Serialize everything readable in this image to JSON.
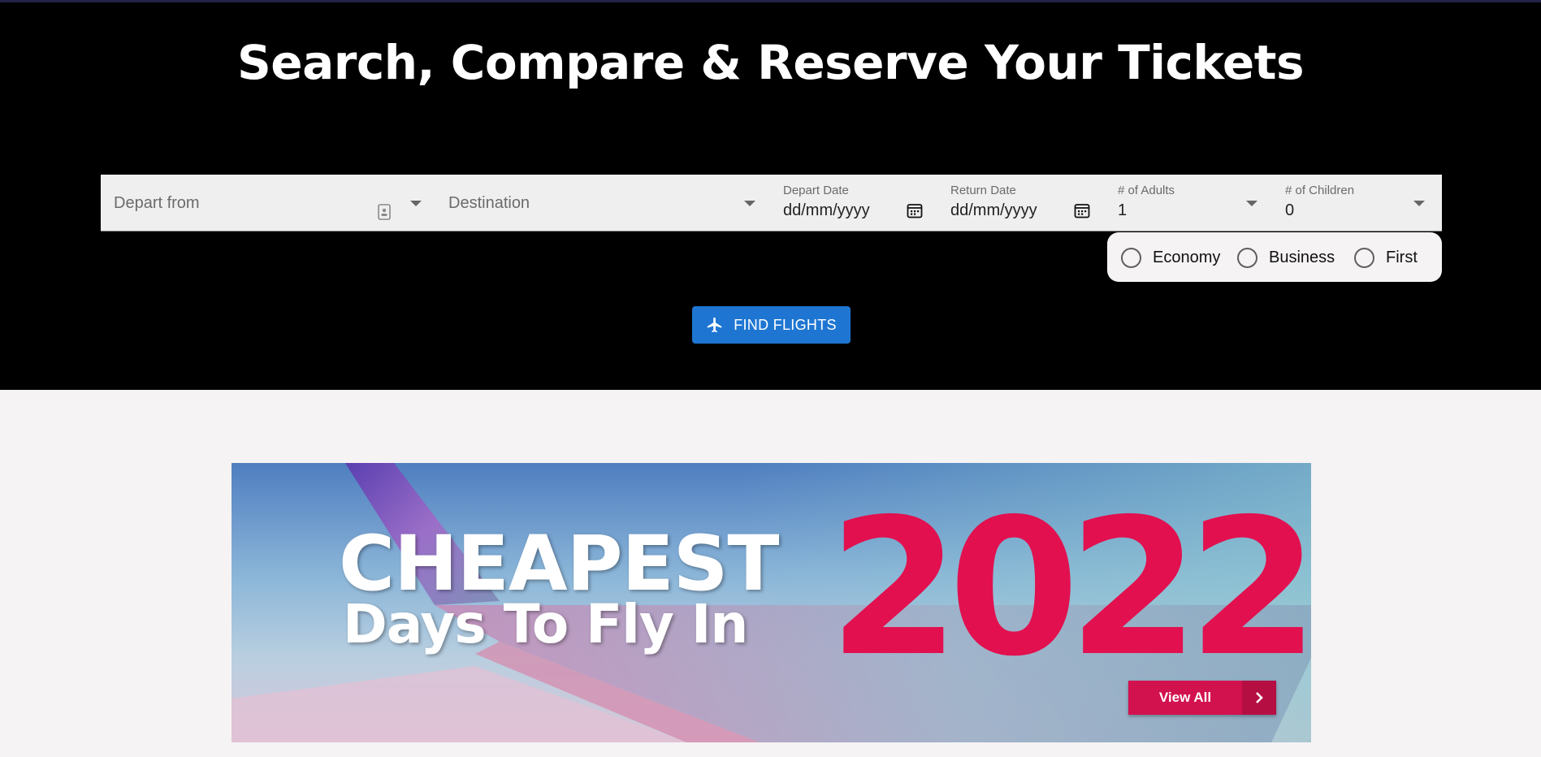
{
  "hero": {
    "title": "Search, Compare & Reserve Your Tickets"
  },
  "search": {
    "depart_from": {
      "placeholder": "Depart from",
      "icon": "contact-card-icon"
    },
    "destination": {
      "placeholder": "Destination"
    },
    "depart_date": {
      "label": "Depart Date",
      "value": "dd/mm/yyyy",
      "icon": "calendar-icon"
    },
    "return_date": {
      "label": "Return Date",
      "value": "dd/mm/yyyy",
      "icon": "calendar-icon"
    },
    "adults": {
      "label": "# of Adults",
      "value": "1"
    },
    "children": {
      "label": "# of Children",
      "value": "0"
    }
  },
  "cabin_class": {
    "options": [
      "Economy",
      "Business",
      "First"
    ],
    "selected": null
  },
  "find_button": {
    "label": "FIND FLIGHTS",
    "icon": "airplane-icon",
    "color": "#1e76d2"
  },
  "banner": {
    "line1": "CHEAPEST",
    "line2": "Days To Fly In",
    "year": "2022",
    "cta": "View All",
    "accent": "#e2104f"
  }
}
